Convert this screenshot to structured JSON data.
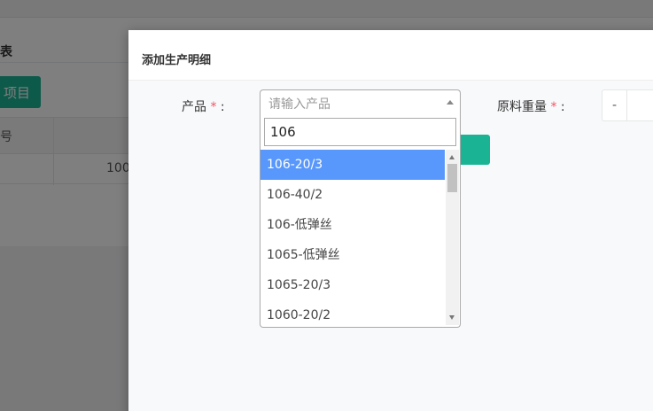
{
  "background": {
    "panel_title": "表",
    "add_button_label": "项目",
    "table": {
      "header_cell": "号",
      "row_cell": "100"
    }
  },
  "modal": {
    "title": "添加生产明细",
    "product_field": {
      "label": "产品",
      "required_mark": "*",
      "colon": ":",
      "placeholder": "请输入产品"
    },
    "weight_field": {
      "label": "原料重量",
      "required_mark": "*",
      "colon": ":",
      "stepper_minus_label": "-"
    },
    "dropdown": {
      "search_value": "106",
      "options": [
        {
          "label": "106-20/3",
          "highlighted": true
        },
        {
          "label": "106-40/2",
          "highlighted": false
        },
        {
          "label": "106-低弹丝",
          "highlighted": false
        },
        {
          "label": "1065-低弹丝",
          "highlighted": false
        },
        {
          "label": "1065-20/3",
          "highlighted": false
        },
        {
          "label": "1060-20/2",
          "highlighted": false
        }
      ]
    }
  },
  "colors": {
    "accent_teal": "#1ab394",
    "highlight_blue": "#5897fb",
    "required_red": "#ed5565"
  },
  "icons": [
    "chevron-up-icon",
    "scroll-up-icon",
    "scroll-down-icon"
  ]
}
